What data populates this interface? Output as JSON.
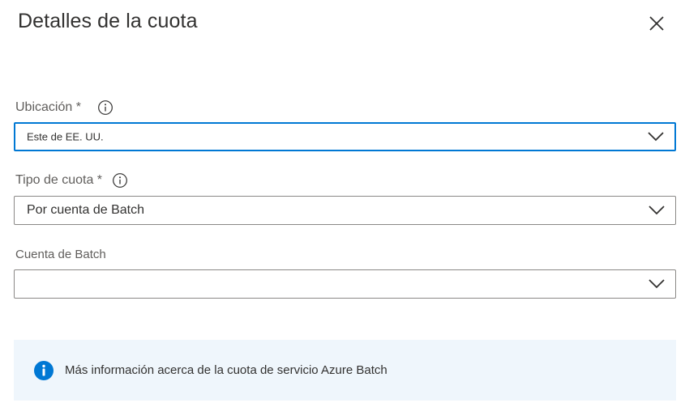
{
  "panel": {
    "title": "Detalles de la cuota",
    "close_icon": "close-icon"
  },
  "fields": {
    "location": {
      "label": "Ubicación *",
      "value": "Este de EE. UU.",
      "info_icon": "info-icon"
    },
    "quota_type": {
      "label": "Tipo de cuota *",
      "value": "Por cuenta de Batch",
      "info_icon": "info-icon"
    },
    "batch_account": {
      "label": "Cuenta de Batch",
      "value": ""
    }
  },
  "info_bar": {
    "text": "Más información acerca de la cuota de servicio Azure Batch",
    "icon": "info-circle-icon"
  },
  "colors": {
    "accent": "#0078d4",
    "info_bg": "#eff6fc",
    "border": "#8a8886",
    "text": "#323130",
    "label": "#605e5c"
  }
}
